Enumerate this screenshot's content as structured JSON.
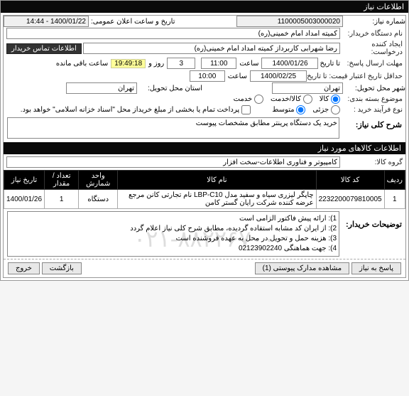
{
  "title": "اطلاعات نیاز",
  "labels": {
    "need_no": "شماره نیاز:",
    "need_no_val": "1100005003000020",
    "public_date": "تاریخ و ساعت اعلان عمومی:",
    "public_date_val": "1400/01/22 - 14:44",
    "buyer_name": "نام دستگاه خریدار:",
    "buyer_val": "کمیته امداد امام خمینی(ره)",
    "creator": "ایجاد کننده درخواست:",
    "creator_val": "رضا شهرابی کاربرداز کمیته امداد امام خمینی(ره)",
    "contact_btn": "اطلاعات تماس خریدار",
    "deadline": "مهلت ارسال پاسخ:",
    "until": "تا تاریخ",
    "deadline_date": "1400/01/26",
    "time_lbl": "ساعت",
    "deadline_time": "11:00",
    "days": "3",
    "day_and": "روز و",
    "countdown": "19:49:18",
    "remain": "ساعت باقی مانده",
    "min_valid": "حداقل تاریخ اعتبار قیمت: تا تاریخ",
    "min_valid_date": "1400/02/25",
    "min_valid_time": "10:00",
    "deliver_city_lbl": "شهر محل تحویل:",
    "deliver_city": "تهران",
    "deliver_prov_lbl": "استان محل تحویل:",
    "deliver_prov": "تهران",
    "subject_bundle": "موضوع بسته بندی:",
    "r_goods": "کالا",
    "r_service": "کالا/خدمت",
    "r_svc": "خدمت",
    "buy_type": "نوع فرآیند خرید :",
    "r_small": "جزئی",
    "r_medium": "متوسط",
    "settle_note": "پرداخت تمام یا بخشی از مبلغ خریداز محل \"اسناد خزانه اسلامی\" خواهد بود.",
    "settle_chk": false,
    "general_desc_lbl": "شرح کلی نیاز:",
    "general_desc": "خرید یک دستگاه پرینتر مطابق مشخصات پیوست",
    "goods_info_title": "اطلاعات کالاهای مورد نیاز",
    "group_lbl": "گروه کالا:",
    "group_val": "کامپیوتر و فناوری اطلاعات-سخت افزار"
  },
  "table": {
    "headers": [
      "ردیف",
      "کد کالا",
      "نام کالا",
      "واحد شمارش",
      "تعداد / مقدار",
      "تاریخ نیاز"
    ],
    "rows": [
      {
        "idx": "1",
        "code": "2232200079810005",
        "name": "چاپگر لیزری سیاه و سفید مدل LBP-C10 نام تجارتی کانن مرجع عرضه کننده شرکت رایان گستر کامن",
        "unit": "دستگاه",
        "qty": "1",
        "date": "1400/01/26"
      }
    ]
  },
  "buyer_explain_lbl": "توضیحات خریدار:",
  "buyer_explain": [
    "1): ارائه پیش فاکتور الزامی است",
    "2): از ایران کد مشابه استفاده گردیده، مطابق شرح کلی نیاز اعلام گردد",
    "3): هزینه حمل و تحویل در محل به عهده فروشنده است",
    "4): جهت هماهنگی 02123902240"
  ],
  "bottom": {
    "reply": "پاسخ به نیاز",
    "attach": "مشاهده مدارک پیوستی (1)",
    "back": "بازگشت",
    "exit": "خروج"
  },
  "watermark": "۰۲۱-۸۸۲۲۶۷۰۰"
}
